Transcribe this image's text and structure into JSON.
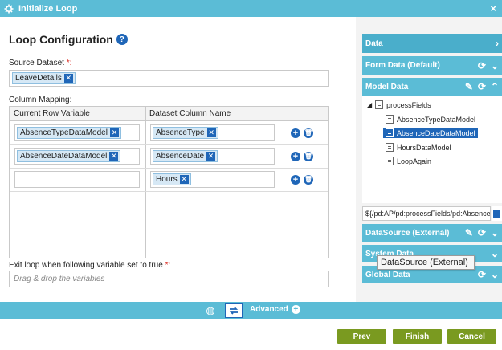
{
  "window": {
    "title": "Initialize Loop",
    "close_glyph": "×"
  },
  "config": {
    "heading": "Loop Configuration",
    "help_glyph": "?",
    "source_label": "Source Dataset",
    "source_required": "*:",
    "source_chip": "LeaveDetails",
    "column_mapping_label": "Column Mapping:",
    "grid_headers": [
      "Current Row Variable",
      "Dataset Column Name"
    ],
    "rows": [
      {
        "variable": "AbsenceTypeDataModel",
        "column": "AbsenceType"
      },
      {
        "variable": "AbsenceDateDataModel",
        "column": "AbsenceDate"
      },
      {
        "variable": "",
        "column": "Hours"
      }
    ],
    "exit_label": "Exit loop when following variable set to true",
    "exit_required": "*:",
    "exit_placeholder": "Drag & drop the variables"
  },
  "data_panel": {
    "header": "Data",
    "sections": [
      {
        "label": "Form Data (Default)"
      },
      {
        "label": "Model Data"
      },
      {
        "label": "DataSource (External)"
      },
      {
        "label": "System Data"
      },
      {
        "label": "Global Data"
      }
    ],
    "tree_root": "processFields",
    "tree_items": [
      "AbsenceTypeDataModel",
      "AbsenceDateDataModel",
      "HoursDataModel",
      "LoopAgain"
    ],
    "selected_item": "AbsenceDateDataModel",
    "path_value": "${/pd:AP/pd:processFields/pd:AbsenceDateDataModel}",
    "tooltip": "DataSource (External)"
  },
  "bottom": {
    "advanced_label": "Advanced"
  },
  "footer": {
    "prev": "Prev",
    "finish": "Finish",
    "cancel": "Cancel"
  },
  "colors": {
    "accent": "#5bbcd6",
    "primary": "#1f66b8",
    "button": "#7a9a20",
    "required": "#d9261c"
  }
}
